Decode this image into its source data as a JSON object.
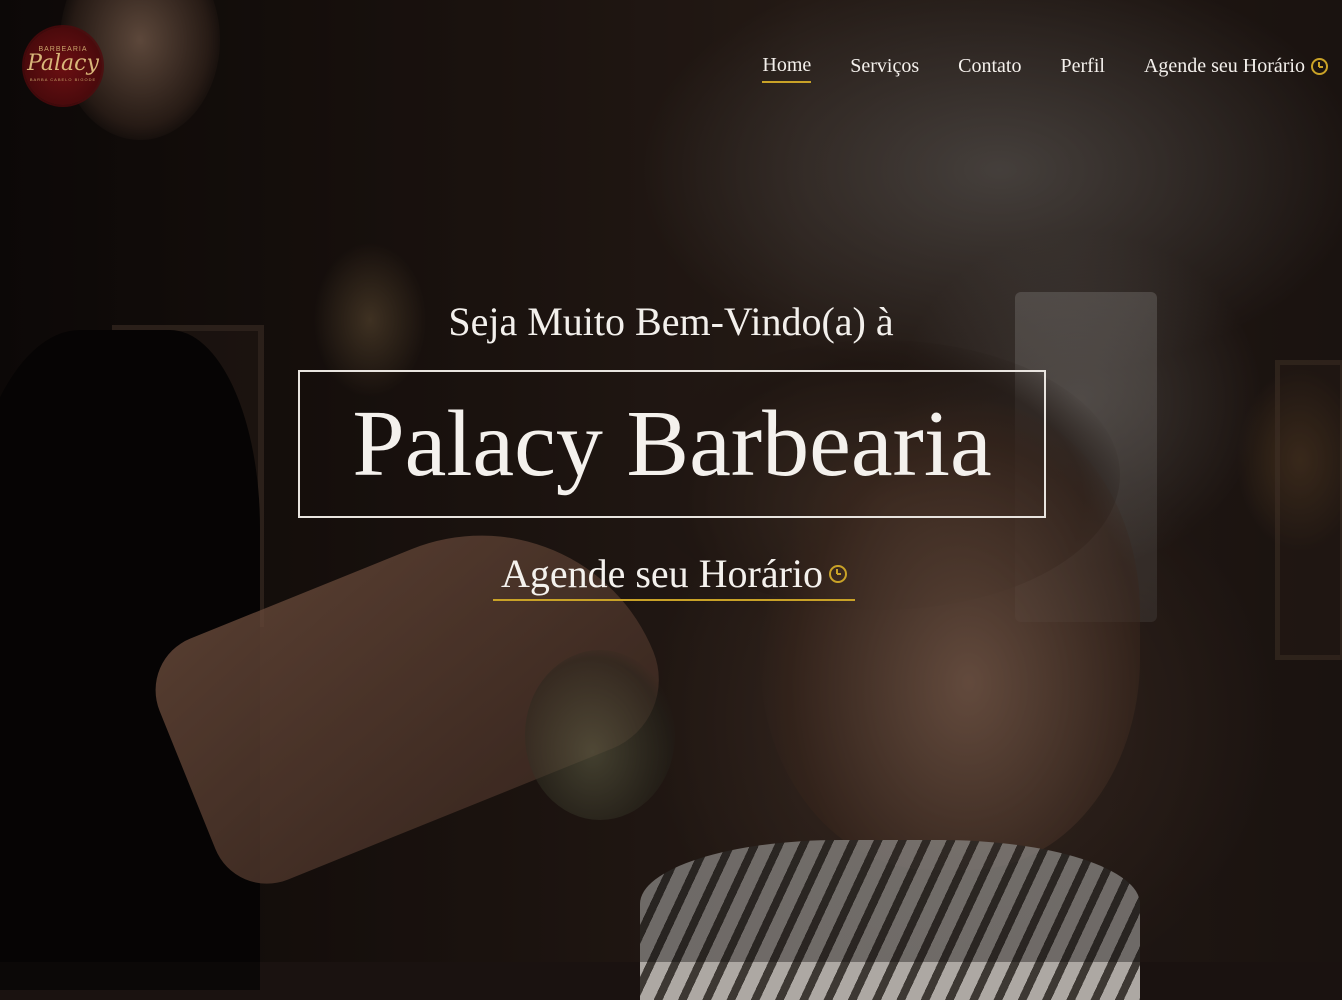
{
  "brand": {
    "logo_top": "BARBEARIA",
    "logo_main": "Palacy",
    "logo_bottom": "BARBA CABELO BIGODE",
    "accent_color": "#c9a227",
    "logo_color": "#6b0f12"
  },
  "nav": {
    "items": [
      {
        "label": "Home",
        "active": true
      },
      {
        "label": "Serviços",
        "active": false
      },
      {
        "label": "Contato",
        "active": false
      },
      {
        "label": "Perfil",
        "active": false
      },
      {
        "label": "Agende seu Horário",
        "active": false,
        "icon": "clock-icon"
      }
    ]
  },
  "hero": {
    "welcome": "Seja Muito Bem-Vindo(a) à",
    "title": "Palacy Barbearia",
    "cta_label": "Agende seu Horário",
    "cta_icon": "clock-icon"
  }
}
